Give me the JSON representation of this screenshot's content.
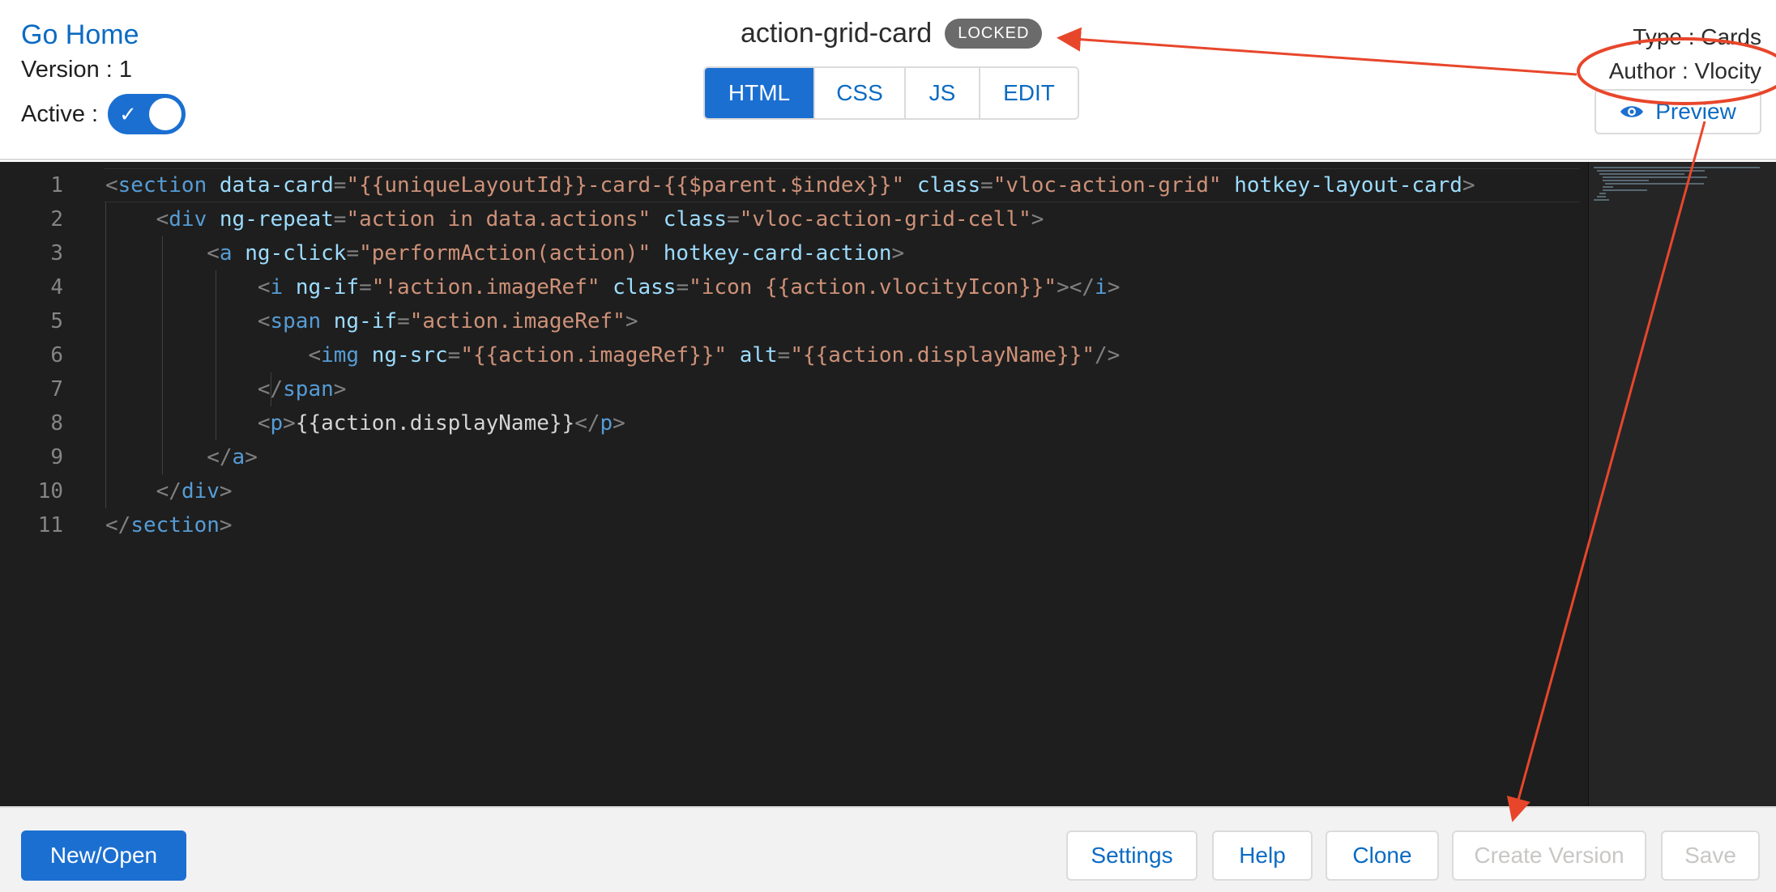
{
  "header": {
    "go_home": "Go Home",
    "version_label": "Version : 1",
    "active_label": "Active :",
    "active_on": true,
    "card_name": "action-grid-card",
    "locked_badge": "LOCKED",
    "tabs": [
      {
        "label": "HTML",
        "active": true
      },
      {
        "label": "CSS",
        "active": false
      },
      {
        "label": "JS",
        "active": false
      },
      {
        "label": "EDIT",
        "active": false
      }
    ],
    "type_label": "Type : Cards",
    "author_label": "Author : Vlocity",
    "preview_label": "Preview",
    "preview_icon": "eye-icon"
  },
  "editor": {
    "line_numbers": [
      "1",
      "2",
      "3",
      "4",
      "5",
      "6",
      "7",
      "8",
      "9",
      "10",
      "11"
    ],
    "lines": [
      "<section data-card=\"{{uniqueLayoutId}}-card-{{$parent.$index}}\" class=\"vloc-action-grid\" hotkey-layout-card>",
      "    <div ng-repeat=\"action in data.actions\" class=\"vloc-action-grid-cell\">",
      "        <a ng-click=\"performAction(action)\" hotkey-card-action>",
      "            <i ng-if=\"!action.imageRef\" class=\"icon {{action.vlocityIcon}}\"></i>",
      "            <span ng-if=\"action.imageRef\">",
      "                <img ng-src=\"{{action.imageRef}}\" alt=\"{{action.displayName}}\"/>",
      "            </span>",
      "            <p>{{action.displayName}}</p>",
      "        </a>",
      "    </div>",
      "</section>"
    ]
  },
  "footer": {
    "new_open": "New/Open",
    "settings": "Settings",
    "help": "Help",
    "clone": "Clone",
    "create_version": "Create Version",
    "save": "Save"
  },
  "colors": {
    "brand": "#1b6fd1",
    "link": "#0b6bc2",
    "editor_bg": "#1e1e1e",
    "annotation": "#e8462b"
  }
}
